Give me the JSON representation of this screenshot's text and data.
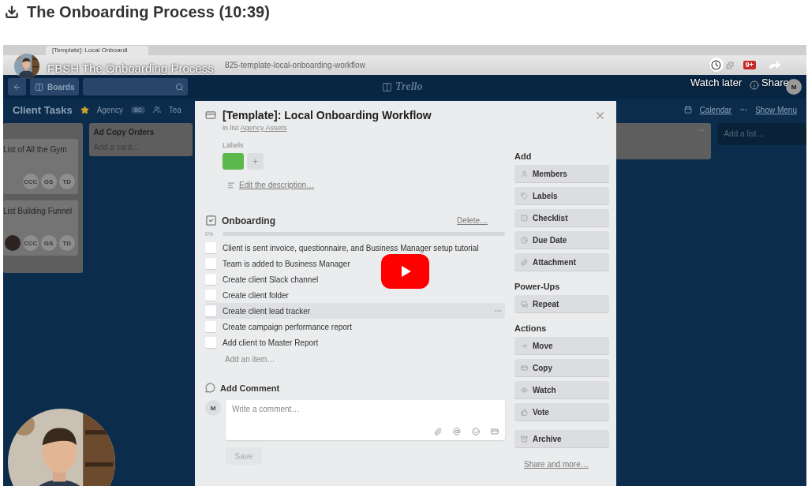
{
  "page_title": "The Onboarding Process (10:39)",
  "video": {
    "title": "FBSH The Onboarding Process",
    "actions": [
      {
        "label": "Watch later"
      },
      {
        "label": "Share"
      }
    ],
    "browser": {
      "tab": "[Template]: Local Onboardi",
      "url": "825-template-local-onboarding-workflow",
      "badge": "9+"
    },
    "header": {
      "boards": "Boards",
      "logo": "Trello",
      "avatar": "M"
    },
    "board_bar": {
      "name": "Client Tasks",
      "starred": true,
      "team": "Agency",
      "team_badge": "BC",
      "visibility": "Tea",
      "links": [
        "Calendar",
        "Show Menu"
      ]
    },
    "lists": [
      {
        "cards": [
          {
            "title": "List of All the Gym",
            "members": [
              "CCC",
              "GS",
              "TD"
            ],
            "photo": false
          },
          {
            "title": "List Building Funnel",
            "members": [
              "CCC",
              "GS",
              "TD"
            ],
            "photo": true
          }
        ]
      },
      {
        "title": "Ad Copy Orders",
        "add_card": "Add a card…"
      },
      {
        "menu": true
      }
    ],
    "add_list": "Add a list…",
    "card": {
      "title": "[Template]: Local Onboarding Workflow",
      "list_prefix": "in list",
      "list_name": "Agency Assets",
      "labels_heading": "Labels",
      "labels": [
        {
          "color": "#5bb84a"
        }
      ],
      "add_label": "+",
      "description_link": "Edit the description…",
      "checklist": {
        "title": "Onboarding",
        "delete": "Delete…",
        "percent": "0%",
        "level": 0,
        "items": [
          {
            "text": "Client is sent invoice, questionnaire, and Business Manager setup tutorial",
            "checked": false,
            "hovered": false
          },
          {
            "text": "Team is added to Business Manager",
            "checked": false,
            "hovered": false
          },
          {
            "text": "Create client Slack channel",
            "checked": false,
            "hovered": false
          },
          {
            "text": "Create client folder",
            "checked": false,
            "hovered": false
          },
          {
            "text": "Create client lead tracker",
            "checked": false,
            "hovered": true
          },
          {
            "text": "Create campaign performance report",
            "checked": false,
            "hovered": false
          },
          {
            "text": "Add client to Master Report",
            "checked": false,
            "hovered": false
          }
        ],
        "add_item": "Add an item…"
      },
      "comment": {
        "heading": "Add Comment",
        "avatar": "M",
        "placeholder": "Write a comment…",
        "save": "Save",
        "save_disabled": true
      },
      "sidebar": [
        {
          "heading": "Add",
          "buttons": [
            "Members",
            "Labels",
            "Checklist",
            "Due Date",
            "Attachment"
          ]
        },
        {
          "heading": "Power-Ups",
          "buttons": [
            "Repeat"
          ]
        },
        {
          "heading": "Actions",
          "buttons": [
            "Move",
            "Copy",
            "Watch",
            "Vote",
            "Archive"
          ]
        }
      ],
      "share_link": "Share and more…"
    }
  }
}
